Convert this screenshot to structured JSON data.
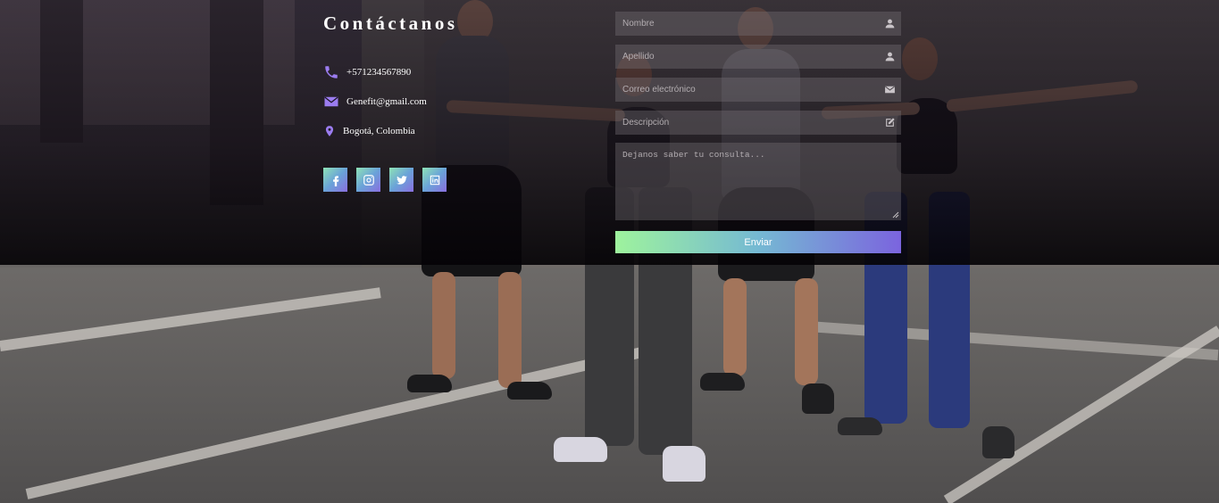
{
  "contact": {
    "title": "Contáctanos",
    "phone": "+571234567890",
    "email": "Genefit@gmail.com",
    "location": "Bogotá, Colombia",
    "icons": {
      "phone": "phone-icon",
      "email": "envelope-icon",
      "location": "map-pin-icon"
    },
    "socials": [
      {
        "name": "facebook",
        "icon": "facebook-icon"
      },
      {
        "name": "instagram",
        "icon": "instagram-icon"
      },
      {
        "name": "twitter",
        "icon": "twitter-icon"
      },
      {
        "name": "linkedin",
        "icon": "linkedin-icon"
      }
    ]
  },
  "form": {
    "first_name_placeholder": "Nombre",
    "last_name_placeholder": "Apellido",
    "email_placeholder": "Correo electrónico",
    "description_placeholder": "Descripción",
    "message_placeholder": "Dejanos saber tu consulta...",
    "submit_label": "Enviar",
    "icons": {
      "first_name": "user-icon",
      "last_name": "user-icon",
      "email": "envelope-icon",
      "description": "edit-icon"
    }
  },
  "colors": {
    "accent": "#9b7cf0",
    "gradient_start": "#9ef39d",
    "gradient_end": "#7b64de",
    "overlay": "#0f0a12"
  }
}
